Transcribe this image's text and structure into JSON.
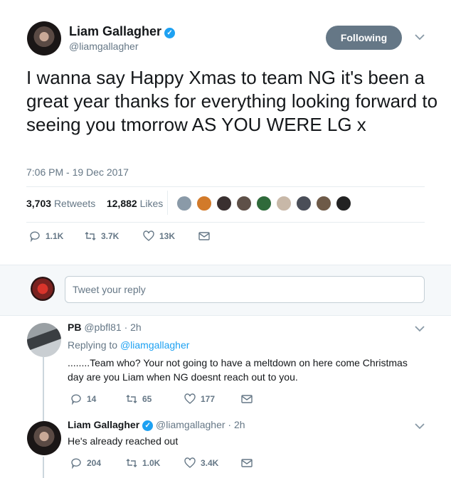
{
  "tweet": {
    "author_name": "Liam Gallagher",
    "author_handle": "@liamgallagher",
    "follow_label": "Following",
    "text": "I wanna say Happy Xmas to team NG it's been a great year thanks for everything looking forward to seeing you tmorrow AS YOU WERE LG x",
    "timestamp": "7:06 PM - 19 Dec 2017",
    "retweets_count": "3,703",
    "retweets_label": "Retweets",
    "likes_count": "12,882",
    "likes_label": "Likes",
    "replies": "1.1K",
    "retweets_short": "3.7K",
    "likes_short": "13K"
  },
  "reply_box": {
    "placeholder": "Tweet your reply"
  },
  "replies": [
    {
      "name": "PB",
      "handle": "@pbfl81",
      "time": "· 2h",
      "replying_prefix": "Replying to",
      "replying_to": "@liamgallagher",
      "text": "........Team who?  Your not going to have a meltdown on here come Christmas day are you Liam when NG doesnt reach out to you.",
      "reply_count": "14",
      "retweet_count": "65",
      "like_count": "177"
    },
    {
      "name": "Liam Gallagher",
      "handle": "@liamgallagher",
      "time": "· 2h",
      "text": "He's already reached out",
      "reply_count": "204",
      "retweet_count": "1.0K",
      "like_count": "3.4K"
    }
  ],
  "colors": {
    "accent": "#1da1f2",
    "muted": "#657786",
    "follow_bg": "#657786"
  }
}
